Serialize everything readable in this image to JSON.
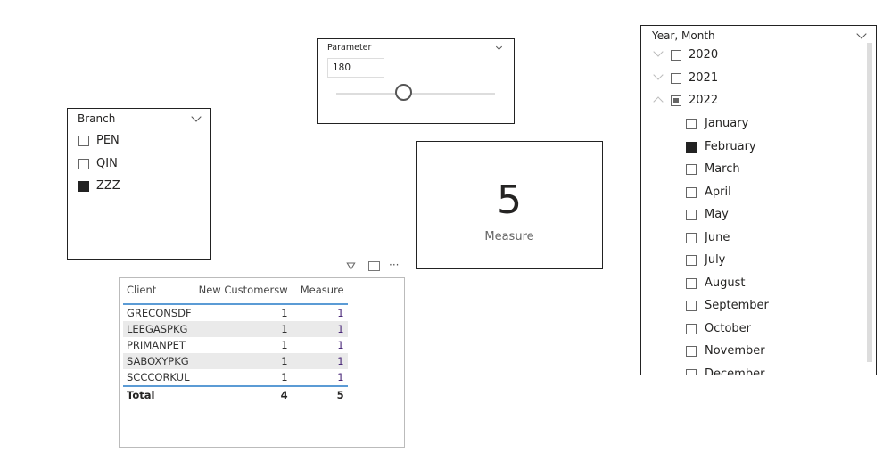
{
  "parameter": {
    "title": "Parameter",
    "value": "180",
    "slider_fraction": 0.42
  },
  "branch": {
    "title": "Branch",
    "items": [
      {
        "label": "PEN",
        "checked": false
      },
      {
        "label": "QIN",
        "checked": false
      },
      {
        "label": "ZZZ",
        "checked": true
      }
    ]
  },
  "card": {
    "value": "5",
    "label": "Measure"
  },
  "table": {
    "columns": [
      "Client",
      "New Customersw",
      "Measure"
    ],
    "rows": [
      [
        "GRECONSDF",
        "1",
        "1"
      ],
      [
        "LEEGASPKG",
        "1",
        "1"
      ],
      [
        "PRIMANPET",
        "1",
        "1"
      ],
      [
        "SABOXYPKG",
        "1",
        "1"
      ],
      [
        "SCCCORKUL",
        "1",
        "1"
      ]
    ],
    "total": [
      "Total",
      "4",
      "5"
    ],
    "accent": "#5b9bd5",
    "measure_color": "#4b2a7a"
  },
  "yearmonth": {
    "title": "Year, Month",
    "years": [
      {
        "label": "2020",
        "state": "unchecked",
        "expanded": false
      },
      {
        "label": "2021",
        "state": "unchecked",
        "expanded": false
      },
      {
        "label": "2022",
        "state": "partial",
        "expanded": true
      }
    ],
    "months": [
      {
        "label": "January",
        "checked": false
      },
      {
        "label": "February",
        "checked": true
      },
      {
        "label": "March",
        "checked": false
      },
      {
        "label": "April",
        "checked": false
      },
      {
        "label": "May",
        "checked": false
      },
      {
        "label": "June",
        "checked": false
      },
      {
        "label": "July",
        "checked": false
      },
      {
        "label": "August",
        "checked": false
      },
      {
        "label": "September",
        "checked": false
      },
      {
        "label": "October",
        "checked": false
      },
      {
        "label": "November",
        "checked": false
      },
      {
        "label": "December",
        "checked": false
      }
    ]
  }
}
